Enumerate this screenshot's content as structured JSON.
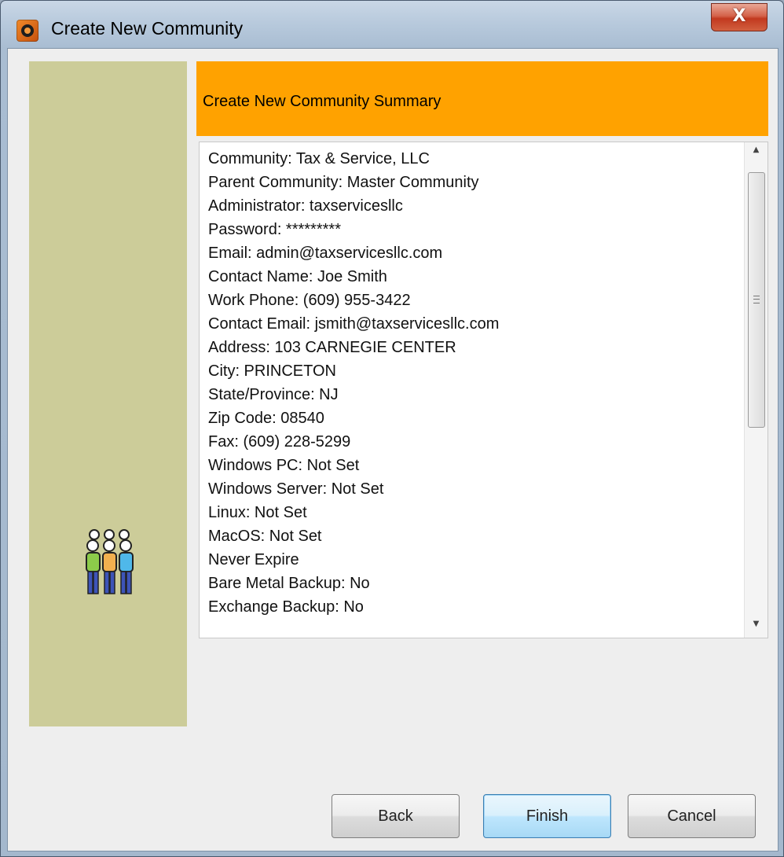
{
  "window": {
    "title": "Create New Community",
    "close_label": "X"
  },
  "header": {
    "title": "Create New Community Summary"
  },
  "summary": {
    "lines": [
      "Community: Tax & Service, LLC",
      "Parent Community: Master Community",
      "Administrator: taxservicesllc",
      "Password: *********",
      "Email: admin@taxservicesllc.com",
      "Contact Name: Joe Smith",
      "Work Phone: (609) 955-3422",
      "Contact Email: jsmith@taxservicesllc.com",
      "Address: 103 CARNEGIE CENTER",
      "City: PRINCETON",
      "State/Province: NJ",
      "Zip Code: 08540",
      "Fax: (609) 228-5299",
      "Windows PC: Not Set",
      "Windows Server: Not Set",
      "Linux: Not Set",
      "MacOS: Not Set",
      "Never Expire",
      "Bare Metal Backup: No",
      "Exchange Backup: No"
    ]
  },
  "buttons": {
    "back": "Back",
    "finish": "Finish",
    "cancel": "Cancel"
  },
  "colors": {
    "header_bg": "#ffa200",
    "side_panel_bg": "#cccc99"
  },
  "icons": {
    "app": "app-logo-icon",
    "side": "community-people-icon",
    "scroll_up": "scroll-up-arrow-icon",
    "scroll_down": "scroll-down-arrow-icon"
  }
}
